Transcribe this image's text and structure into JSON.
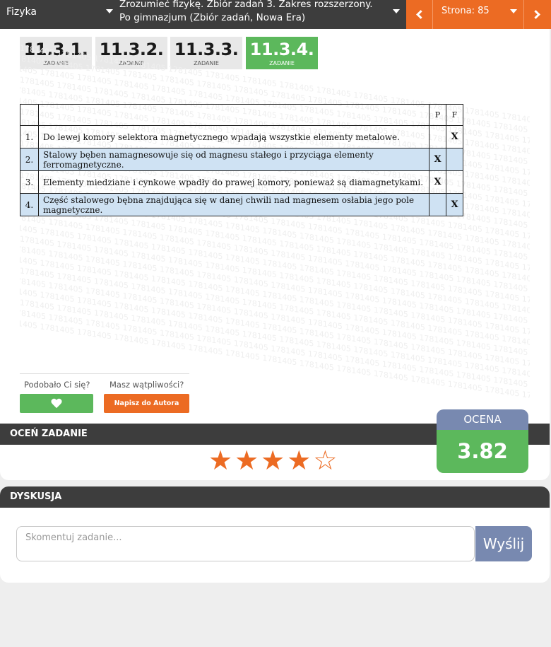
{
  "topbar": {
    "subject": "Fizyka",
    "book_title": "Zrozumieć fizykę. Zbiór zadań 3. Zakres rozszerzony. Po gimnazjum (Zbiór zadań, Nowa Era)",
    "page_label": "Strona: 85"
  },
  "tasks": [
    {
      "number": "11.3.1.",
      "label": "ZADANIE"
    },
    {
      "number": "11.3.2.",
      "label": "ZADANIE"
    },
    {
      "number": "11.3.3.",
      "label": "ZADANIE"
    },
    {
      "number": "11.3.4.",
      "label": "ZADANIE"
    }
  ],
  "watermark_text": "1781405",
  "table": {
    "col_p": "P",
    "col_f": "F",
    "rows": [
      {
        "n": "1.",
        "statement": "Do lewej komory selektora magnetycznego wpadają wszystkie elementy metalowe.",
        "p": "",
        "f": "X"
      },
      {
        "n": "2.",
        "statement": "Stalowy bęben namagnesowuje się od magnesu stałego i przyciąga elementy ferromagnetyczne.",
        "p": "X",
        "f": ""
      },
      {
        "n": "3.",
        "statement": "Elementy miedziane i cynkowe wpadły do prawej komory, ponieważ są diamagnetykami.",
        "p": "X",
        "f": ""
      },
      {
        "n": "4.",
        "statement": "Część stalowego bębna znajdująca się w danej chwili nad magnesem osłabia jego pole magnetyczne.",
        "p": "",
        "f": "X"
      }
    ]
  },
  "feedback": {
    "liked_question": "Podobało Ci się?",
    "doubts_question": "Masz wątpliwości?",
    "author_button": "Napisz do Autora"
  },
  "rating": {
    "header": "OCEŃ ZADANIE",
    "stars_filled": 4,
    "stars_total": 5,
    "ocena_label": "OCENA",
    "ocena_value": "3.82"
  },
  "discussion": {
    "header": "DYSKUSJA",
    "placeholder": "Skomentuj zadanie...",
    "send_label": "Wyślij"
  },
  "colors": {
    "accent_orange": "#ec6b23",
    "green": "#5cb85c",
    "blue_grey": "#7889b0",
    "dark_bar": "#3d3d3d",
    "row_shade": "#cfe2f3"
  }
}
